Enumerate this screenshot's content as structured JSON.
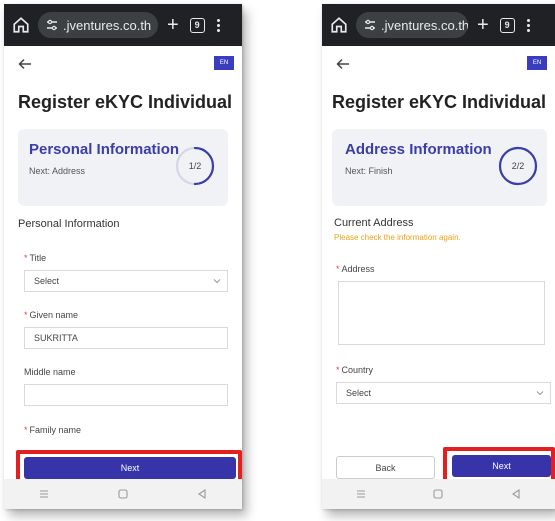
{
  "browser": {
    "url": ".jventures.co.th",
    "tab_count": "9",
    "plus": "+"
  },
  "left": {
    "lang": "EN",
    "page_title": "Register eKYC Individual",
    "step": {
      "title": "Personal Information",
      "next": "Next: Address",
      "indicator": "1/2",
      "progress": 0.5
    },
    "section_title": "Personal Information",
    "fields": {
      "title_label": "Title",
      "title_value": "Select",
      "given_label": "Given name",
      "given_value": "SUKRITTA",
      "middle_label": "Middle name",
      "middle_value": "",
      "family_label": "Family name"
    },
    "next_button": "Next"
  },
  "right": {
    "lang": "EN",
    "page_title": "Register eKYC Individual",
    "step": {
      "title": "Address Information",
      "next": "Next: Finish",
      "indicator": "2/2",
      "progress": 1.0
    },
    "section_title": "Current Address",
    "warning": "Please check the information again.",
    "fields": {
      "address_label": "Address",
      "address_value": "",
      "country_label": "Country",
      "country_value": "Select"
    },
    "back_button": "Back",
    "next_button": "Next"
  },
  "colors": {
    "primary": "#3634a8",
    "highlight": "#e41f1f",
    "warning": "#e8a317",
    "required": "#e0453b"
  },
  "icons": [
    "home-icon",
    "site-settings-icon",
    "tab-switcher-icon",
    "menu-icon",
    "back-arrow-icon",
    "chevron-down-icon",
    "nav-recents-icon",
    "nav-home-icon",
    "nav-back-icon"
  ]
}
